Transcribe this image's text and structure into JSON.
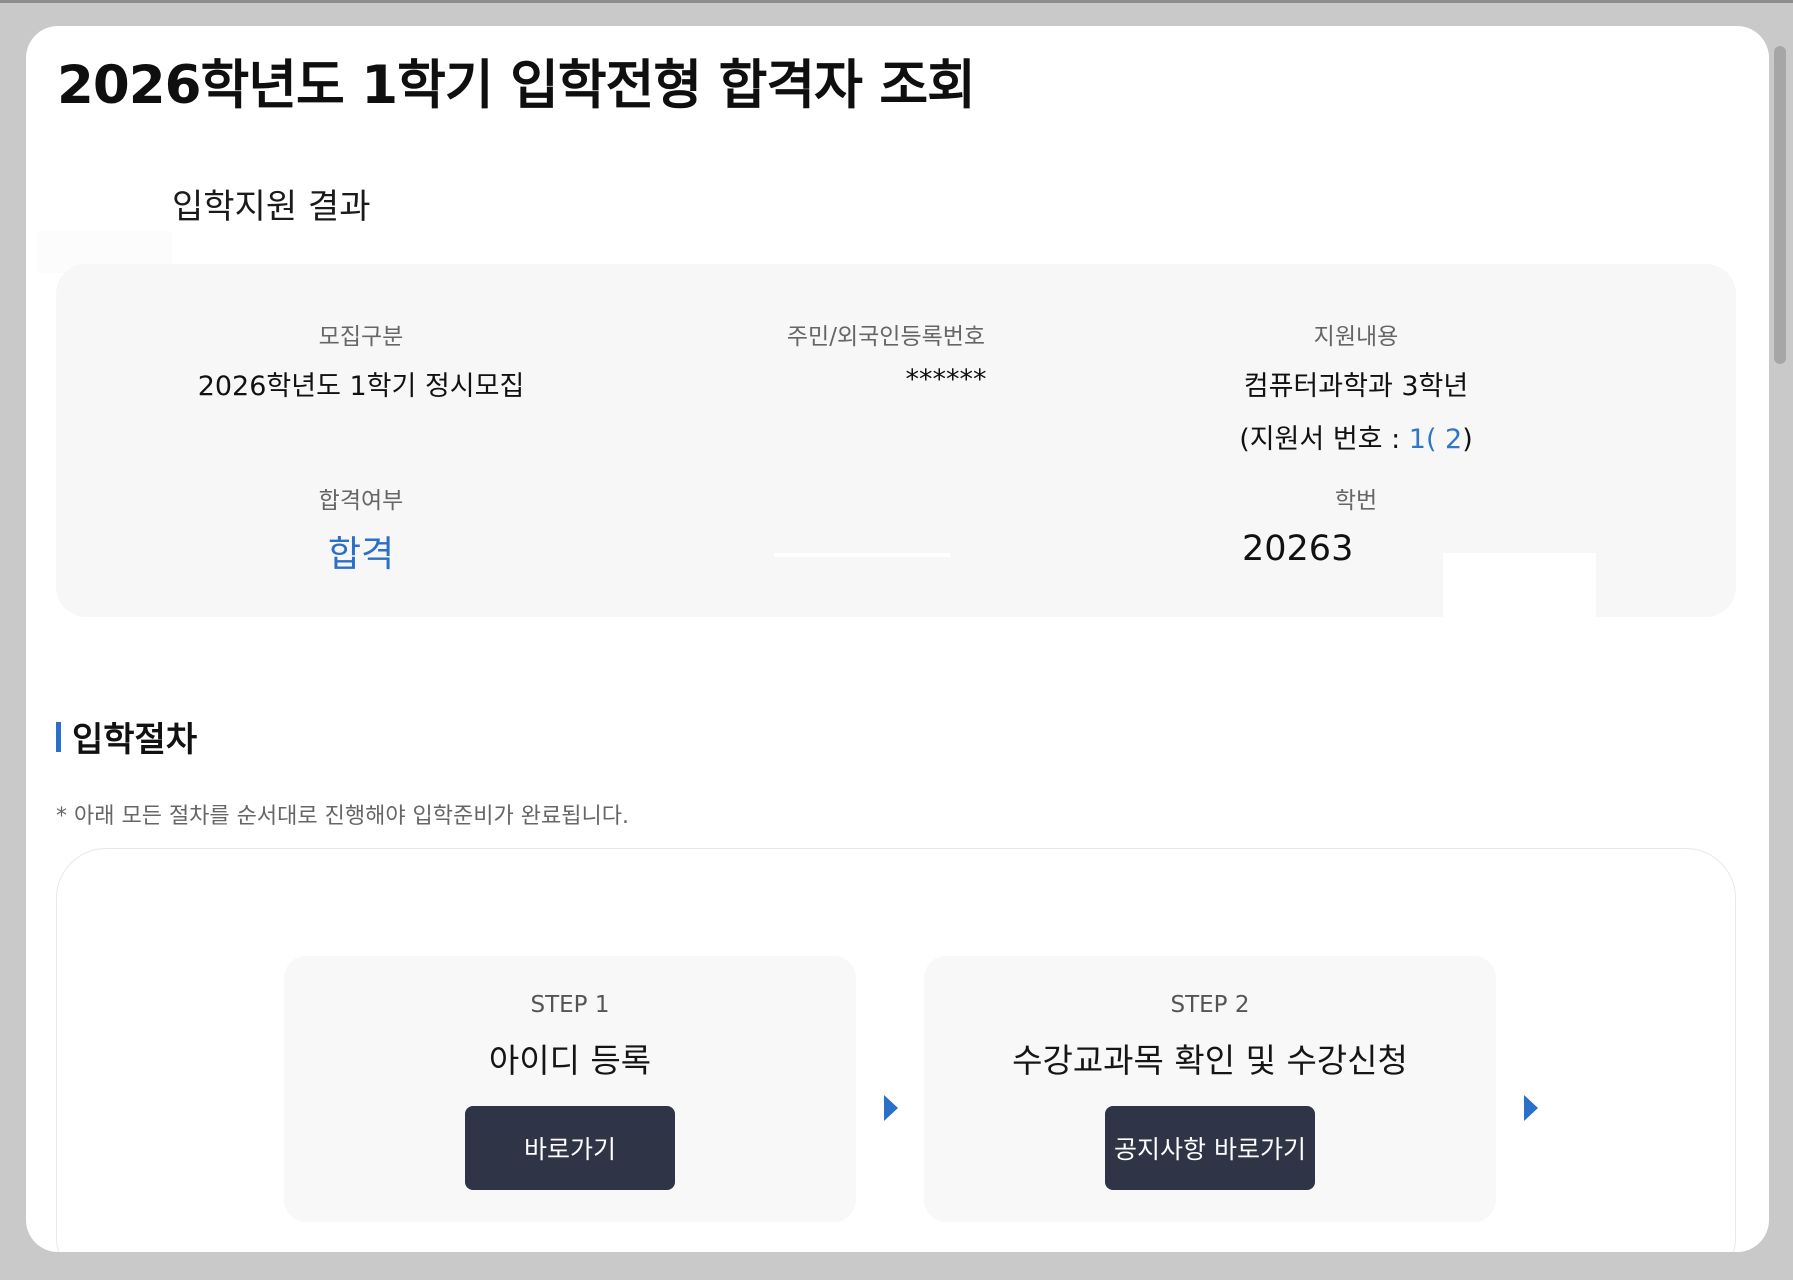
{
  "page": {
    "title": "2026학년도 1학기 입학전형 합격자 조회"
  },
  "result": {
    "heading": "입학지원 결과",
    "recruit_label": "모집구분",
    "recruit_value": "2026학년도 1학기 정시모집",
    "id_label": "주민/외국인등록번호",
    "id_value": "******",
    "apply_label": "지원내용",
    "apply_value": "컴퓨터과학과 3학년",
    "apply_no_prefix": "(지원서 번호 : ",
    "apply_no_value": "1(      2",
    "apply_no_suffix": ")",
    "pass_label": "합격여부",
    "pass_value": "합격",
    "student_no_label": "학번",
    "student_no_value": "20263"
  },
  "procedure": {
    "heading": "입학절차",
    "note": "* 아래 모든 절차를 순서대로 진행해야 입학준비가 완료됩니다.",
    "steps": [
      {
        "label": "STEP 1",
        "title": "아이디 등록",
        "button": "바로가기"
      },
      {
        "label": "STEP 2",
        "title": "수강교과목 확인 및 수강신청",
        "button": "공지사항 바로가기"
      }
    ]
  },
  "colors": {
    "accent": "#2a6fc8",
    "button": "#2f3447",
    "card_bg": "#f7f7f7",
    "backdrop": "#c9c9c9"
  },
  "icons": {
    "step_arrow": "triangle-right-icon"
  }
}
